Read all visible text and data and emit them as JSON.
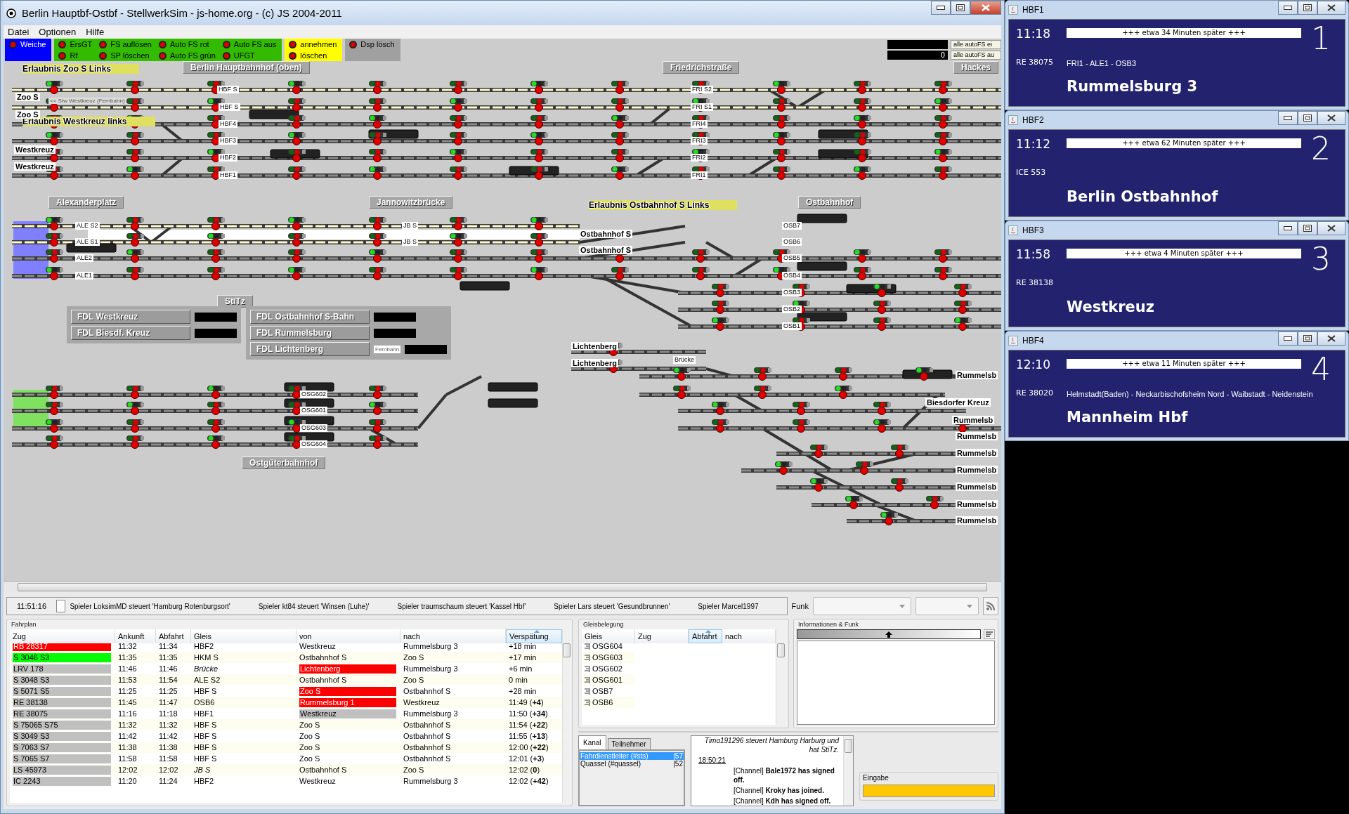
{
  "window": {
    "title": "Berlin Hauptbf-Ostbf - StellwerkSim - js-home.org - (c) JS 2004-2011"
  },
  "menu": [
    "Datei",
    "Optionen",
    "Hilfe"
  ],
  "toolbar": {
    "groups": [
      {
        "color": "#0000ff",
        "buttons": [
          "Weiche"
        ]
      },
      {
        "color": "#33bb00",
        "buttons": [
          "ErsGT",
          "Rf",
          "FS auflösen",
          "SP löschen",
          "Auto FS rot",
          "Auto FS grün",
          "Auto FS aus",
          "UFGT"
        ]
      },
      {
        "color": "#ffff00",
        "buttons": [
          "annehmen",
          "löschen"
        ]
      },
      {
        "color": "#a0a0a0",
        "buttons": [
          "Dsp lösch"
        ]
      }
    ],
    "counter": "0",
    "auto_buttons": [
      "alle autoFS ei",
      "alle autoFS au"
    ]
  },
  "track_diagram": {
    "station_headers": [
      "Berlin Hauptbahnhof (oben)",
      "Friedrichstraße",
      "Hackes",
      "Alexanderplatz",
      "Jannowitzbrücke",
      "Ostbahnhof",
      "StiTz",
      "Ostgüterbahnhof"
    ],
    "permission_labels": [
      "Erlaubnis Zoo S Links",
      "Erlaubnis Westkreuz links",
      "Erlaubnis Ostbahnhof S Links"
    ],
    "end_labels": [
      "Zoo S",
      "Zoo S",
      "Westkreuz",
      "Westkreuz",
      "Ostbahnhof S",
      "Ostbahnhof S",
      "Lichtenberg",
      "Lichtenberg",
      "Rummelsb",
      "Biesdorfer Kreuz",
      "Rummelsb",
      "Rummelsb",
      "Rummelsb",
      "Rummelsb",
      "Rummelsb",
      "Rummelsb",
      "Rummelsb"
    ],
    "track_labels": [
      "HBF S",
      "HBF S",
      "HBF4",
      "HBF3",
      "HBF2",
      "HBF1",
      "FRI S2",
      "FRI S1",
      "FRI4",
      "FRI3",
      "FRI2",
      "FRI1",
      "ALE S2",
      "ALE S1",
      "ALE2",
      "ALE1",
      "JB S",
      "JB S",
      "OSB7",
      "OSB6",
      "OSB5",
      "OSB4",
      "OSB3",
      "OSB2",
      "OSB1",
      "OSG602",
      "OSG601",
      "OSG603",
      "OSG604",
      "Brücke"
    ],
    "notes": [
      "<< Stw Westkreuz (Fernbahn)"
    ],
    "fdl_panels": [
      {
        "buttons": [
          {
            "label": "FDL Westkreuz"
          },
          {
            "label": "FDL Biesdf. Kreuz"
          }
        ]
      },
      {
        "buttons": [
          {
            "label": "FDL Ostbahnhof S-Bahn"
          },
          {
            "label": "FDL Rummelsburg"
          },
          {
            "label": "FDL Lichtenberg",
            "note": "Fernbahn"
          }
        ]
      }
    ]
  },
  "ticker": {
    "time": "11:51:16",
    "messages": [
      "Spieler LoksimMD steuert 'Hamburg Rotenburgsort'",
      "Spieler kt84 steuert 'Winsen (Luhe)'",
      "Spieler traumschaum steuert 'Kassel Hbf'",
      "Spieler Lars steuert 'Gesundbrunnen'",
      "Spieler Marcel1997"
    ],
    "funk_label": "Funk"
  },
  "fahrplan": {
    "title": "Fahrplan",
    "columns": [
      {
        "label": "Zug",
        "sorted": false
      },
      {
        "label": "Ankunft",
        "sorted": false
      },
      {
        "label": "Abfahrt",
        "sorted": false
      },
      {
        "label": "Gleis",
        "sorted": false
      },
      {
        "label": "von",
        "sorted": false
      },
      {
        "label": "nach",
        "sorted": false
      },
      {
        "label": "Verspätung",
        "sorted": true
      }
    ],
    "rows": [
      {
        "zug": "RB 28317",
        "color": "#ff0000",
        "ankunft": "11:32",
        "abfahrt": "11:34",
        "gleis": "HBF2",
        "gleis_changed": false,
        "von": "Westkreuz",
        "nach": "Rummelsburg 3",
        "delay": "+18 min"
      },
      {
        "zug": "S 3046 S3",
        "color": "#00ff00",
        "ankunft": "11:35",
        "abfahrt": "11:35",
        "gleis": "HKM S",
        "gleis_changed": false,
        "von": "Ostbahnhof S",
        "nach": "Zoo S",
        "delay": "+17 min"
      },
      {
        "zug": "LRV 178",
        "color": "#c0c0c0",
        "ankunft": "11:46",
        "abfahrt": "11:46",
        "gleis": "Brücke",
        "gleis_changed": true,
        "von": "Lichtenberg",
        "von_mark": {
          "color": "#ff0000"
        },
        "nach": "Rummelsburg 3",
        "delay": "+6 min"
      },
      {
        "zug": "S 3048 S3",
        "color": "#c0c0c0",
        "ankunft": "11:53",
        "abfahrt": "11:54",
        "gleis": "ALE S2",
        "gleis_changed": false,
        "von": "Ostbahnhof S",
        "nach": "Zoo S",
        "delay": "0 min"
      },
      {
        "zug": "S 5071 S5",
        "color": "#c0c0c0",
        "ankunft": "11:25",
        "abfahrt": "11:25",
        "gleis": "HBF S",
        "gleis_changed": false,
        "von": "Zoo S",
        "von_mark": {
          "color": "#ff0000"
        },
        "nach": "Ostbahnhof S",
        "delay": "+28 min"
      },
      {
        "zug": "RE 38138",
        "color": "#c0c0c0",
        "ankunft": "11:45",
        "abfahrt": "11:47",
        "gleis": "OSB6",
        "gleis_changed": false,
        "von": "Rummelsburg 1",
        "von_mark": {
          "color": "#ff0000"
        },
        "nach": "Westkreuz",
        "delay": "11:49 (**+4**)"
      },
      {
        "zug": "RE 38075",
        "color": "#c0c0c0",
        "ankunft": "11:16",
        "abfahrt": "11:18",
        "gleis": "HBF1",
        "gleis_changed": false,
        "von": "Westkreuz",
        "von_mark": {
          "color": "#c0c0c0"
        },
        "nach": "Rummelsburg 3",
        "delay": "11:50 (**+34**)"
      },
      {
        "zug": "S 75065 S75",
        "color": "#c0c0c0",
        "ankunft": "11:32",
        "abfahrt": "11:32",
        "gleis": "HBF S",
        "gleis_changed": false,
        "von": "Zoo S",
        "nach": "Ostbahnhof S",
        "delay": "11:54 (**+22**)"
      },
      {
        "zug": "S 3049 S3",
        "color": "#c0c0c0",
        "ankunft": "11:42",
        "abfahrt": "11:42",
        "gleis": "HBF S",
        "gleis_changed": false,
        "von": "Zoo S",
        "nach": "Ostbahnhof S",
        "delay": "11:55 (**+13**)"
      },
      {
        "zug": "S 7063 S7",
        "color": "#c0c0c0",
        "ankunft": "11:38",
        "abfahrt": "11:38",
        "gleis": "HBF S",
        "gleis_changed": false,
        "von": "Zoo S",
        "nach": "Ostbahnhof S",
        "delay": "12:00 (**+22**)"
      },
      {
        "zug": "S 7065 S7",
        "color": "#c0c0c0",
        "ankunft": "11:58",
        "abfahrt": "11:58",
        "gleis": "HBF S",
        "gleis_changed": false,
        "von": "Zoo S",
        "nach": "Ostbahnhof S",
        "delay": "12:01 (**+3**)"
      },
      {
        "zug": "LS 45973",
        "color": "#c0c0c0",
        "ankunft": "12:02",
        "abfahrt": "12:02",
        "gleis": "JB S",
        "gleis_changed": true,
        "von": "Ostbahnhof S",
        "nach": "Zoo S",
        "delay": "12:02 (**0**)"
      },
      {
        "zug": "IC 2243",
        "color": "#c0c0c0",
        "ankunft": "11:20",
        "abfahrt": "11:24",
        "gleis": "HBF2",
        "gleis_changed": false,
        "von": "Westkreuz",
        "nach": "Rummelsburg 3",
        "delay": "12:02 (**+42**)"
      }
    ]
  },
  "gleisbelegung": {
    "title": "Gleisbelegung",
    "columns": [
      {
        "label": "Gleis",
        "sorted": false
      },
      {
        "label": "Zug",
        "sorted": false
      },
      {
        "label": "Abfahrt",
        "sorted": true
      },
      {
        "label": "nach",
        "sorted": false
      }
    ],
    "rows": [
      "OSG604",
      "OSG603",
      "OSG602",
      "OSG601",
      "OSB7",
      "OSB6"
    ]
  },
  "info": {
    "title": "Informationen & Funk"
  },
  "chat": {
    "tabs": [
      {
        "label": "Kanal",
        "selected": true
      },
      {
        "label": "Teilnehmer",
        "selected": false
      }
    ],
    "channels": [
      {
        "name": "Fahrdienstleiter (#sts)",
        "count": "|57",
        "selected": true
      },
      {
        "name": "Quassel (#quassel)",
        "count": "|52",
        "selected": false
      }
    ],
    "log": [
      {
        "kind": "action",
        "text": "Timo191296 steuert Hamburg Harburg und hat StiTz."
      },
      {
        "kind": "time",
        "text": "18:50:21"
      },
      {
        "kind": "message",
        "text": "[Channel] **Bale1972 has signed off.**"
      },
      {
        "kind": "message",
        "text": "[Channel] **Kroky has joined.**"
      },
      {
        "kind": "message",
        "text": "[Channel] **Kdh has signed off.**"
      }
    ],
    "input_label": "Eingabe"
  },
  "displays": [
    {
      "title": "HBF1",
      "time": "11:18",
      "train": "RE 38075",
      "notice": "+++ etwa 34 Minuten später +++",
      "via": "FRI1 - ALE1 - OSB3",
      "destination": "Rummelsburg 3",
      "platform": "1"
    },
    {
      "title": "HBF2",
      "time": "11:12",
      "train": "ICE 553",
      "notice": "+++ etwa 62 Minuten später +++",
      "destination": "Berlin Ostbahnhof",
      "platform": "2"
    },
    {
      "title": "HBF3",
      "time": "11:58",
      "train": "RE 38138",
      "notice": "+++ etwa 4 Minuten später +++",
      "destination": "Westkreuz",
      "platform": "3"
    },
    {
      "title": "HBF4",
      "time": "12:10",
      "train": "RE 38020",
      "notice": "+++ etwa 11 Minuten später +++",
      "via": "Helmstadt(Baden) - Neckarbischofsheim Nord - Waibstadt - Neidenstein",
      "destination": "Mannheim Hbf",
      "platform": "4"
    }
  ]
}
